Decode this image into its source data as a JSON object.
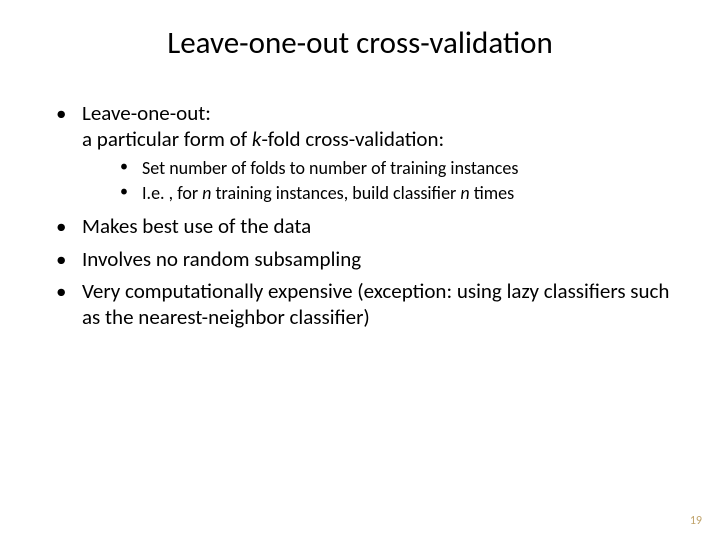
{
  "title": "Leave-one-out cross-validation",
  "bullets": {
    "b1_line1": "Leave-one-out:",
    "b1_line2_pre": "a particular form of ",
    "b1_line2_k": "k",
    "b1_line2_post": "-fold cross-validation:",
    "sub1": "Set number of folds to number of training instances",
    "sub2_pre": "I.e. , for ",
    "sub2_n1": "n",
    "sub2_mid": " training instances, build classifier ",
    "sub2_n2": "n",
    "sub2_post": " times",
    "b2": "Makes best use of the data",
    "b3": "Involves no random subsampling",
    "b4": "Very computationally expensive (exception: using lazy classifiers such as the nearest-neighbor classifier)"
  },
  "page_number": "19"
}
